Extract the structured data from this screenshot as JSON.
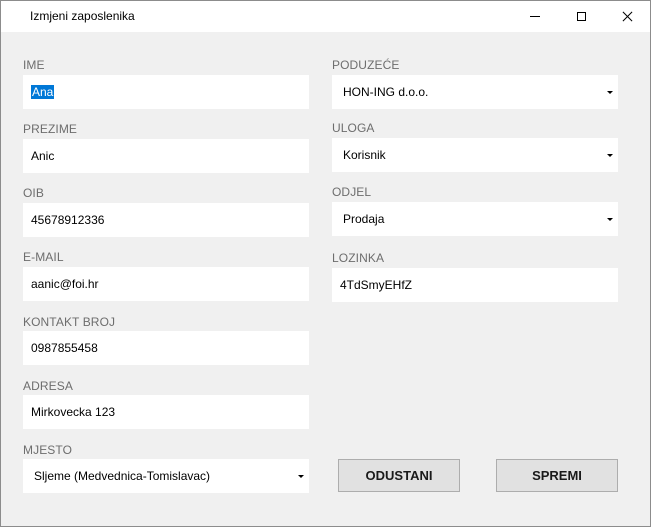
{
  "window": {
    "title": "Izmjeni zaposlenika"
  },
  "controls": {
    "minimize": "minimize",
    "maximize": "maximize",
    "close": "close"
  },
  "form": {
    "ime": {
      "label": "IME",
      "value": "Ana"
    },
    "prezime": {
      "label": "PREZIME",
      "value": "Anic"
    },
    "oib": {
      "label": "OIB",
      "value": "45678912336"
    },
    "email": {
      "label": "E-MAIL",
      "value": "aanic@foi.hr"
    },
    "kontakt": {
      "label": "KONTAKT BROJ",
      "value": "0987855458"
    },
    "adresa": {
      "label": "ADRESA",
      "value": "Mirkovecka 123"
    },
    "mjesto": {
      "label": "MJESTO",
      "value": "Sljeme (Medvednica-Tomislavac)"
    },
    "poduzece": {
      "label": "PODUZEĆE",
      "value": "HON-ING d.o.o."
    },
    "uloga": {
      "label": "ULOGA",
      "value": "Korisnik"
    },
    "odjel": {
      "label": "ODJEL",
      "value": "Prodaja"
    },
    "lozinka": {
      "label": "LOZINKA",
      "value": "4TdSmyEHfZ"
    }
  },
  "buttons": {
    "odustani": "ODUSTANI",
    "spremi": "SPREMI"
  },
  "colors": {
    "selection": "#0078d7",
    "background": "#f0f0f0",
    "label": "#6d6d6d"
  },
  "icons": {
    "minimize": "minimize-icon",
    "maximize": "maximize-icon",
    "close": "close-icon",
    "dropdown": "chevron-down-icon"
  }
}
